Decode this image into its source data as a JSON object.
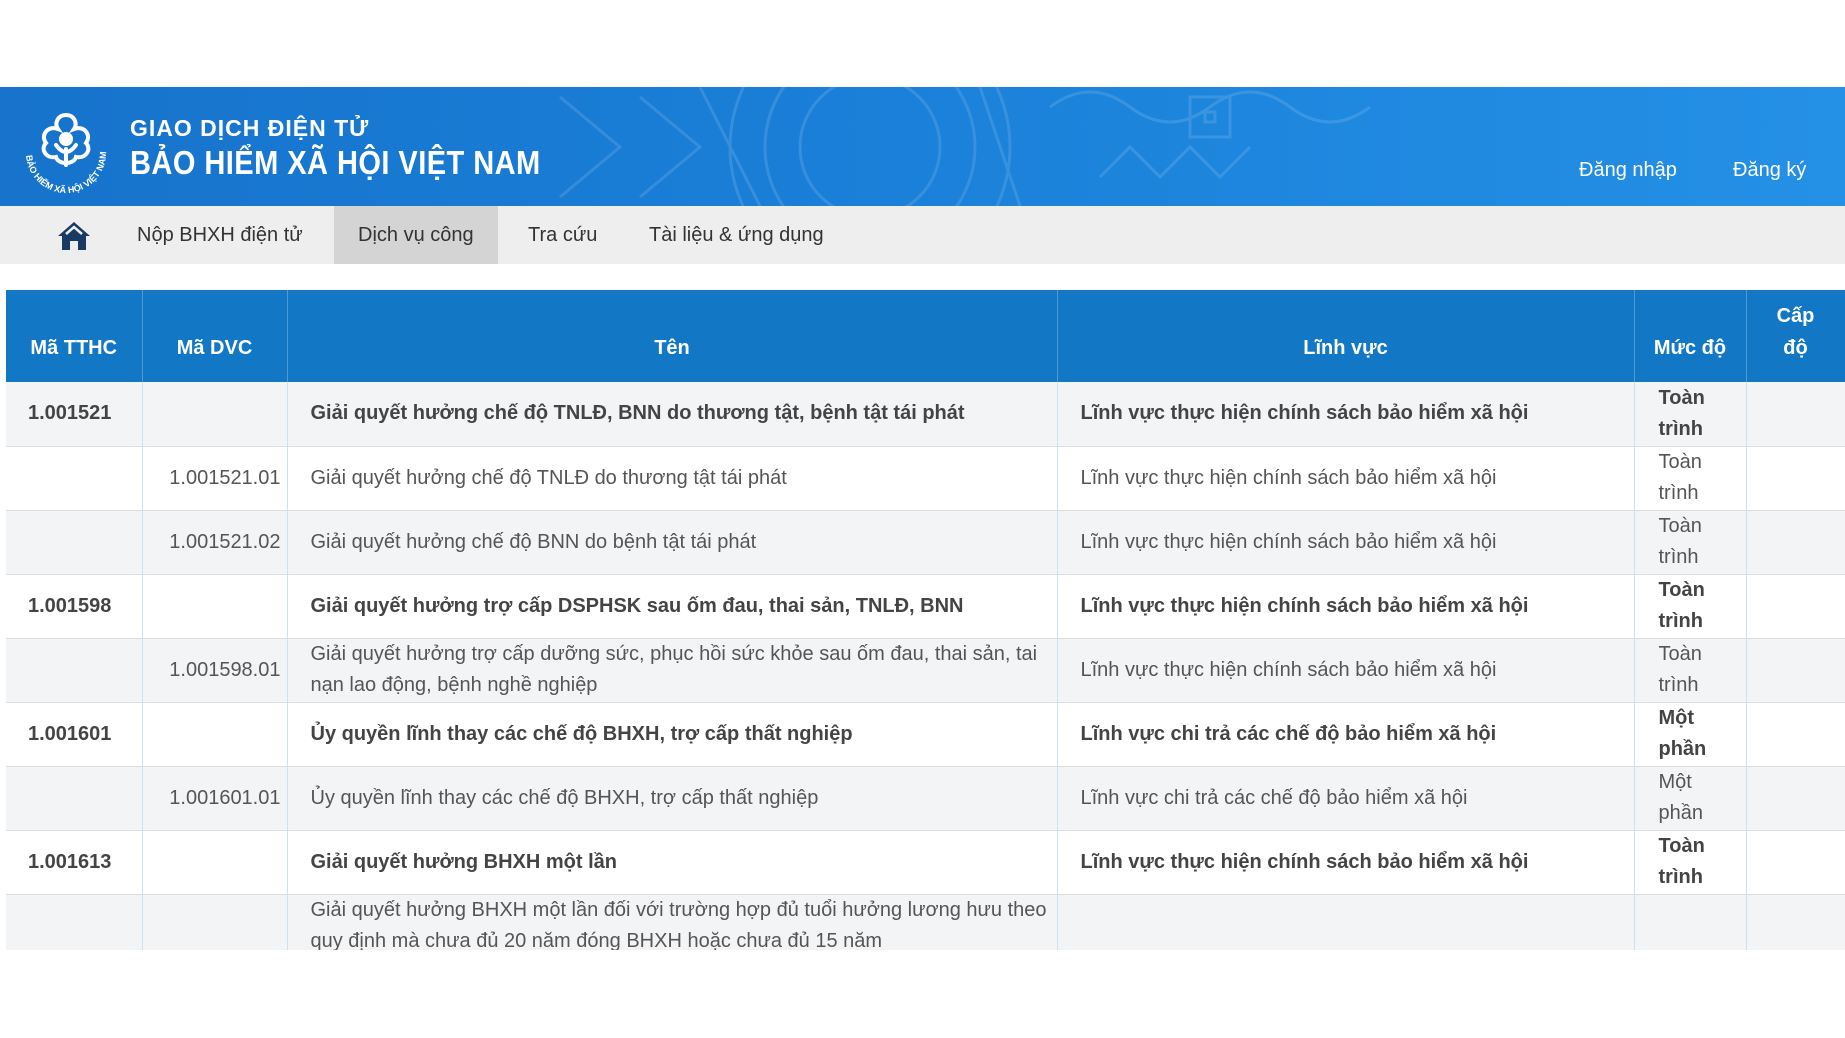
{
  "header": {
    "brand_line1": "GIAO DỊCH ĐIỆN TỬ",
    "brand_line2": "BẢO HIỂM XÃ HỘI VIỆT NAM",
    "logo_text": "BẢO HIỂM XÃ HỘI VIỆT NAM",
    "login_label": "Đăng nhập",
    "register_label": "Đăng ký"
  },
  "nav": {
    "home_icon": "home-icon",
    "items": [
      {
        "label": "Nộp BHXH điện tử",
        "active": false
      },
      {
        "label": "Dịch vụ công",
        "active": true
      },
      {
        "label": "Tra cứu",
        "active": false
      },
      {
        "label": "Tài liệu & ứng dụng",
        "active": false
      }
    ]
  },
  "table": {
    "headers": [
      "Mã TTHC",
      "Mã DVC",
      "Tên",
      "Lĩnh vực",
      "Mức độ",
      "Cấp độ"
    ],
    "rows": [
      {
        "ma_tthc": "1.001521",
        "ma_dvc": "",
        "ten": "Giải quyết hưởng chế độ TNLĐ, BNN do thương tật, bệnh tật tái phát",
        "linh_vuc": "Lĩnh vực thực hiện chính sách bảo hiểm xã hội",
        "muc_do": "Toàn trình",
        "cap_do": "",
        "parent": true
      },
      {
        "ma_tthc": "",
        "ma_dvc": "1.001521.01",
        "ten": "Giải quyết hưởng chế độ TNLĐ do thương tật tái phát",
        "linh_vuc": "Lĩnh vực thực hiện chính sách bảo hiểm xã hội",
        "muc_do": "Toàn trình",
        "cap_do": "",
        "parent": false
      },
      {
        "ma_tthc": "",
        "ma_dvc": "1.001521.02",
        "ten": "Giải quyết hưởng chế độ BNN do bệnh tật tái phát",
        "linh_vuc": "Lĩnh vực thực hiện chính sách bảo hiểm xã hội",
        "muc_do": "Toàn trình",
        "cap_do": "",
        "parent": false
      },
      {
        "ma_tthc": "1.001598",
        "ma_dvc": "",
        "ten": "Giải quyết hưởng trợ cấp DSPHSK sau ốm đau, thai sản, TNLĐ, BNN",
        "linh_vuc": "Lĩnh vực thực hiện chính sách bảo hiểm xã hội",
        "muc_do": "Toàn trình",
        "cap_do": "",
        "parent": true
      },
      {
        "ma_tthc": "",
        "ma_dvc": "1.001598.01",
        "ten": "Giải quyết hưởng trợ cấp dưỡng sức, phục hồi sức khỏe sau ốm đau, thai sản, tai nạn lao động, bệnh nghề nghiệp",
        "linh_vuc": "Lĩnh vực thực hiện chính sách bảo hiểm xã hội",
        "muc_do": "Toàn trình",
        "cap_do": "",
        "parent": false
      },
      {
        "ma_tthc": "1.001601",
        "ma_dvc": "",
        "ten": "Ủy quyền lĩnh thay các chế độ BHXH, trợ cấp thất nghiệp",
        "linh_vuc": "Lĩnh vực chi trả các chế độ bảo hiểm xã hội",
        "muc_do": "Một phần",
        "cap_do": "",
        "parent": true
      },
      {
        "ma_tthc": "",
        "ma_dvc": "1.001601.01",
        "ten": "Ủy quyền lĩnh thay các chế độ BHXH, trợ cấp thất nghiệp",
        "linh_vuc": "Lĩnh vực chi trả các chế độ bảo hiểm xã hội",
        "muc_do": "Một phần",
        "cap_do": "",
        "parent": false
      },
      {
        "ma_tthc": "1.001613",
        "ma_dvc": "",
        "ten": "Giải quyết hưởng BHXH một lần",
        "linh_vuc": "Lĩnh vực thực hiện chính sách bảo hiểm xã hội",
        "muc_do": "Toàn trình",
        "cap_do": "",
        "parent": true
      },
      {
        "ma_tthc": "",
        "ma_dvc": "",
        "ten": "Giải quyết hưởng BHXH một lần đối với trường hợp đủ tuổi hưởng lương hưu theo quy định mà chưa đủ 20 năm đóng BHXH hoặc chưa đủ 15 năm",
        "linh_vuc": "",
        "muc_do": "",
        "cap_do": "",
        "parent": false
      }
    ]
  }
}
